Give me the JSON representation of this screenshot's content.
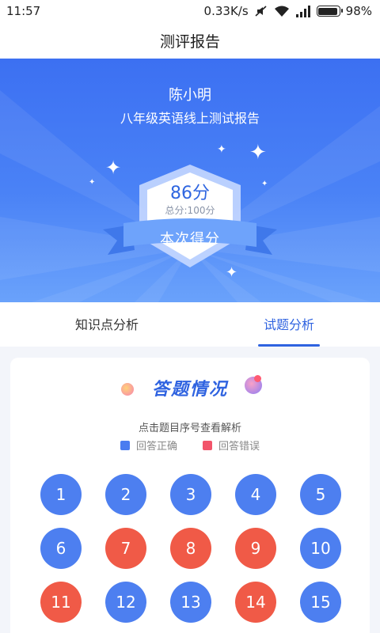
{
  "status_bar": {
    "time": "11:57",
    "network_speed": "0.33K/s",
    "battery": "98%"
  },
  "page": {
    "title": "测评报告"
  },
  "report": {
    "student_name": "陈小明",
    "test_name": "八年级英语线上测试报告",
    "score": "86分",
    "total": "总分:100分",
    "ribbon_label": "本次得分"
  },
  "tabs": [
    {
      "label": "知识点分析",
      "active": false
    },
    {
      "label": "试题分析",
      "active": true
    }
  ],
  "answers": {
    "title": "答题情况",
    "hint": "点击题目序号查看解析",
    "legend": {
      "correct": "回答正确",
      "wrong": "回答错误"
    },
    "colors": {
      "correct": "#4d7ff0",
      "wrong": "#f05a47"
    },
    "questions": [
      {
        "num": "1",
        "status": "correct"
      },
      {
        "num": "2",
        "status": "correct"
      },
      {
        "num": "3",
        "status": "correct"
      },
      {
        "num": "4",
        "status": "correct"
      },
      {
        "num": "5",
        "status": "correct"
      },
      {
        "num": "6",
        "status": "correct"
      },
      {
        "num": "7",
        "status": "wrong"
      },
      {
        "num": "8",
        "status": "wrong"
      },
      {
        "num": "9",
        "status": "wrong"
      },
      {
        "num": "10",
        "status": "correct"
      },
      {
        "num": "11",
        "status": "wrong"
      },
      {
        "num": "12",
        "status": "correct"
      },
      {
        "num": "13",
        "status": "correct"
      },
      {
        "num": "14",
        "status": "wrong"
      },
      {
        "num": "15",
        "status": "correct"
      }
    ]
  }
}
